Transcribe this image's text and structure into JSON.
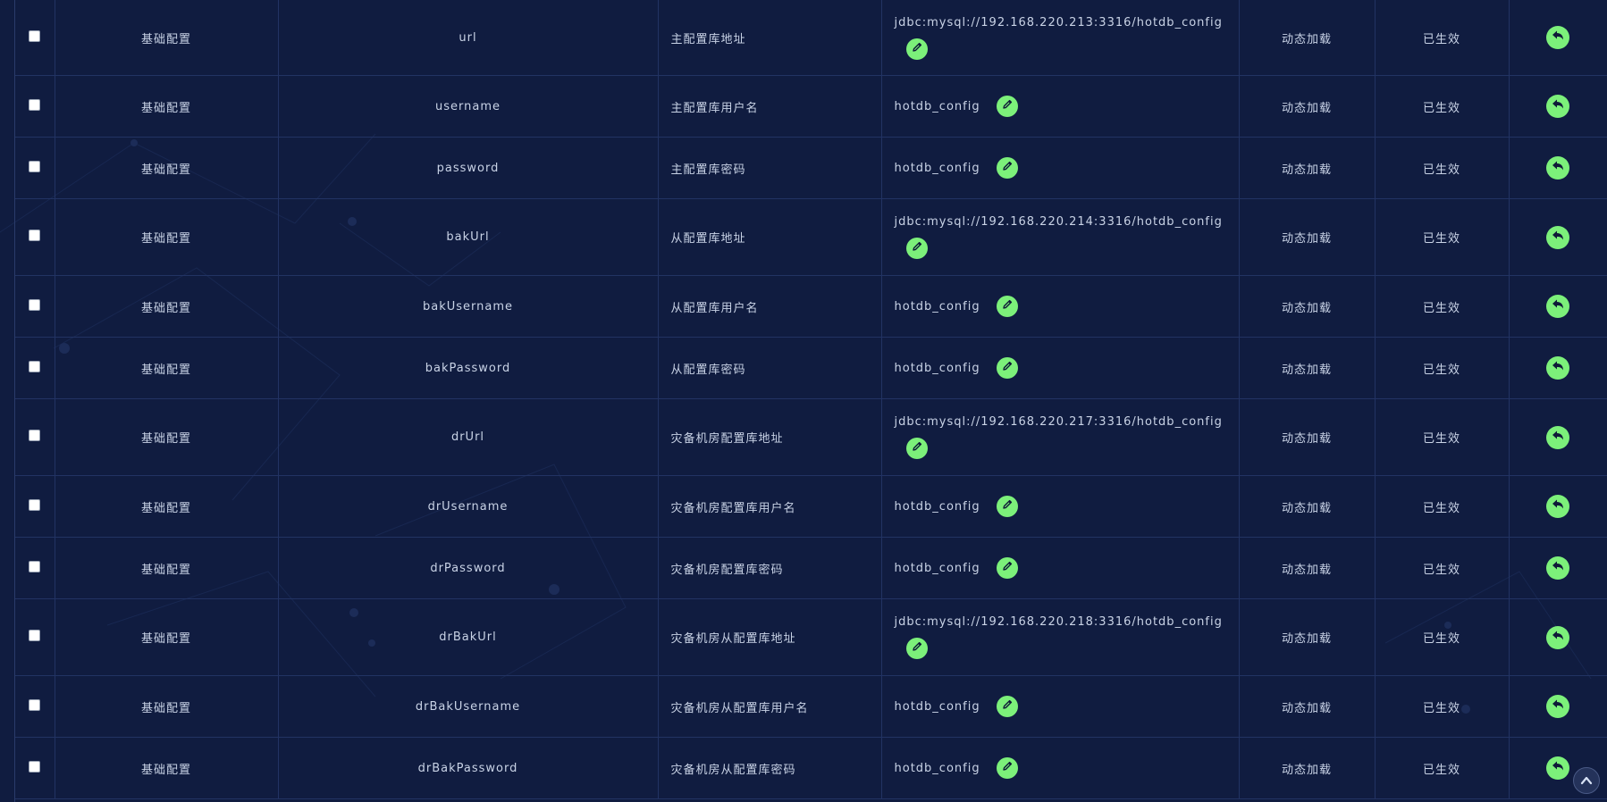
{
  "rows": [
    {
      "category": "基础配置",
      "name": "url",
      "description": "主配置库地址",
      "value": "jdbc:mysql://192.168.220.213:3316/hotdb_config",
      "load_type": "动态加载",
      "status": "已生效"
    },
    {
      "category": "基础配置",
      "name": "username",
      "description": "主配置库用户名",
      "value": "hotdb_config",
      "load_type": "动态加载",
      "status": "已生效"
    },
    {
      "category": "基础配置",
      "name": "password",
      "description": "主配置库密码",
      "value": "hotdb_config",
      "load_type": "动态加载",
      "status": "已生效"
    },
    {
      "category": "基础配置",
      "name": "bakUrl",
      "description": "从配置库地址",
      "value": "jdbc:mysql://192.168.220.214:3316/hotdb_config",
      "load_type": "动态加载",
      "status": "已生效"
    },
    {
      "category": "基础配置",
      "name": "bakUsername",
      "description": "从配置库用户名",
      "value": "hotdb_config",
      "load_type": "动态加载",
      "status": "已生效"
    },
    {
      "category": "基础配置",
      "name": "bakPassword",
      "description": "从配置库密码",
      "value": "hotdb_config",
      "load_type": "动态加载",
      "status": "已生效"
    },
    {
      "category": "基础配置",
      "name": "drUrl",
      "description": "灾备机房配置库地址",
      "value": "jdbc:mysql://192.168.220.217:3316/hotdb_config",
      "load_type": "动态加载",
      "status": "已生效"
    },
    {
      "category": "基础配置",
      "name": "drUsername",
      "description": "灾备机房配置库用户名",
      "value": "hotdb_config",
      "load_type": "动态加载",
      "status": "已生效"
    },
    {
      "category": "基础配置",
      "name": "drPassword",
      "description": "灾备机房配置库密码",
      "value": "hotdb_config",
      "load_type": "动态加载",
      "status": "已生效"
    },
    {
      "category": "基础配置",
      "name": "drBakUrl",
      "description": "灾备机房从配置库地址",
      "value": "jdbc:mysql://192.168.220.218:3316/hotdb_config",
      "load_type": "动态加载",
      "status": "已生效"
    },
    {
      "category": "基础配置",
      "name": "drBakUsername",
      "description": "灾备机房从配置库用户名",
      "value": "hotdb_config",
      "load_type": "动态加载",
      "status": "已生效"
    },
    {
      "category": "基础配置",
      "name": "drBakPassword",
      "description": "灾备机房从配置库密码",
      "value": "hotdb_config",
      "load_type": "动态加载",
      "status": "已生效"
    }
  ],
  "icons": {
    "edit": "pencil-icon",
    "revert": "undo-icon",
    "scroll_top": "chevron-up-icon"
  },
  "colors": {
    "background": "#101c40",
    "accent": "#7cf07a",
    "grid": "#223363",
    "text": "#c9d3e6"
  }
}
